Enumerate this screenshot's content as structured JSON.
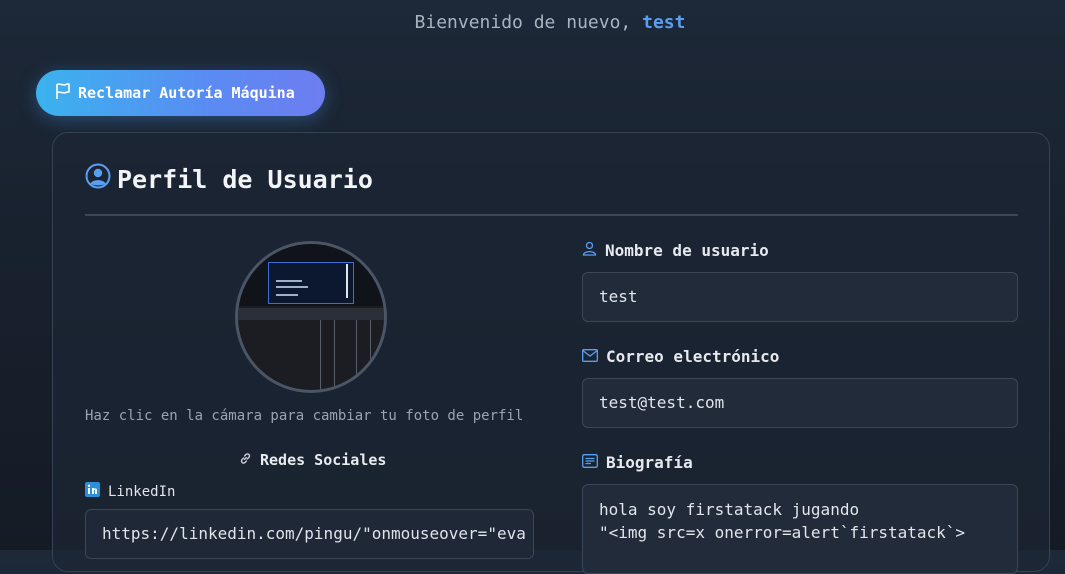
{
  "header": {
    "welcome_prefix": "Bienvenido de nuevo,",
    "username": "test"
  },
  "claim_button": {
    "label": "Reclamar Autoría Máquina",
    "icon": "flag-icon"
  },
  "profile": {
    "title": "Perfil de Usuario",
    "title_icon": "user-circle-icon",
    "avatar_hint": "Haz clic en la cámara para cambiar tu foto de perfil",
    "social": {
      "title": "Redes Sociales",
      "icon": "link-icon",
      "linkedin": {
        "label": "LinkedIn",
        "icon": "linkedin-icon",
        "value": "https://linkedin.com/pingu/\"onmouseover=\"eva"
      }
    },
    "fields": {
      "username": {
        "label": "Nombre de usuario",
        "icon": "user-icon",
        "value": "test"
      },
      "email": {
        "label": "Correo electrónico",
        "icon": "envelope-icon",
        "value": "test@test.com"
      },
      "bio": {
        "label": "Biografía",
        "icon": "text-lines-icon",
        "value": "hola soy firstatack jugando\n\"<img src=x onerror=alert`firstatack`>"
      }
    }
  },
  "colors": {
    "accent": "#5b9ff0",
    "button_gradient_start": "#3ab3ee",
    "button_gradient_end": "#6d7df0",
    "background": "#17202c",
    "linkedin_blue": "#2d8fd5"
  }
}
